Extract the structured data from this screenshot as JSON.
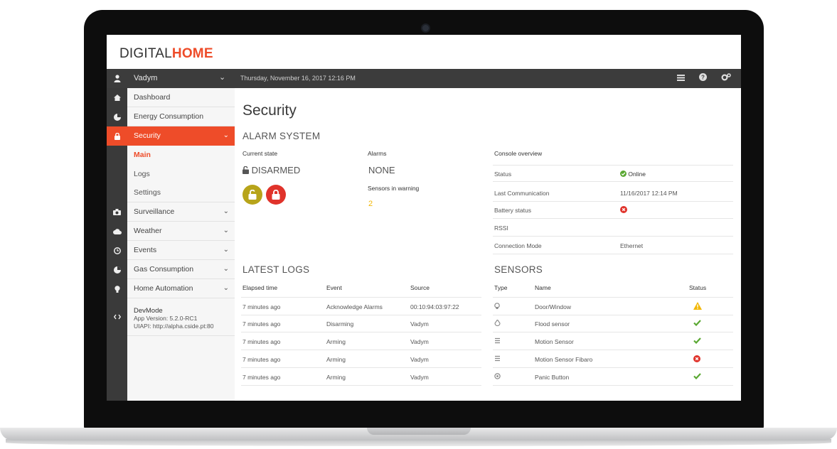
{
  "brand": {
    "part1": "DIGITAL",
    "part2": "HOME"
  },
  "topbar": {
    "user": "Vadym",
    "datetime": "Thursday, November 16, 2017 12:16 PM",
    "icons": [
      "list-icon",
      "help-icon",
      "settings-icon"
    ]
  },
  "sidebar": {
    "items": [
      {
        "label": "Dashboard",
        "icon": "home-icon"
      },
      {
        "label": "Energy Consumption",
        "icon": "pie-chart-icon"
      },
      {
        "label": "Security",
        "icon": "lock-icon",
        "active": true
      },
      {
        "label": "Surveillance",
        "icon": "camera-icon"
      },
      {
        "label": "Weather",
        "icon": "cloud-icon"
      },
      {
        "label": "Events",
        "icon": "clock-icon"
      },
      {
        "label": "Gas Consumption",
        "icon": "pie-chart-icon"
      },
      {
        "label": "Home Automation",
        "icon": "bulb-icon"
      }
    ],
    "security_sub": [
      "Main",
      "Logs",
      "Settings"
    ],
    "dev": {
      "title": "DevMode",
      "version": "App Version: 5.2.0-RC1",
      "uiapi": "UIAPI: http://alpha.cside.pt:80"
    }
  },
  "main": {
    "title": "Security",
    "alarm": {
      "heading": "ALARM SYSTEM",
      "current_state_label": "Current state",
      "current_state": "DISARMED",
      "alarms_label": "Alarms",
      "alarms": "NONE",
      "sensors_warning_label": "Sensors in warning",
      "sensors_warning": "2"
    },
    "console": {
      "heading": "Console overview",
      "rows": [
        {
          "k": "Status",
          "v": "Online",
          "state": "ok"
        },
        {
          "k": "Last Communication",
          "v": "11/16/2017 12:14 PM"
        },
        {
          "k": "Battery status",
          "v": "",
          "state": "error"
        },
        {
          "k": "RSSI",
          "v": ""
        },
        {
          "k": "Connection Mode",
          "v": "Ethernet"
        }
      ]
    },
    "logs": {
      "heading": "LATEST LOGS",
      "columns": [
        "Elapsed time",
        "Event",
        "Source"
      ],
      "rows": [
        [
          "7 minutes ago",
          "Acknowledge Alarms",
          "00:10:94:03:97:22"
        ],
        [
          "7 minutes ago",
          "Disarming",
          "Vadym"
        ],
        [
          "7 minutes ago",
          "Arming",
          "Vadym"
        ],
        [
          "7 minutes ago",
          "Arming",
          "Vadym"
        ],
        [
          "7 minutes ago",
          "Arming",
          "Vadym"
        ]
      ]
    },
    "sensors": {
      "heading": "SENSORS",
      "columns": [
        "Type",
        "Name",
        "Status"
      ],
      "rows": [
        {
          "name": "Door/Window",
          "status": "warning"
        },
        {
          "name": "Flood sensor",
          "status": "ok"
        },
        {
          "name": "Motion Sensor",
          "status": "ok"
        },
        {
          "name": "Motion Sensor Fibaro",
          "status": "error"
        },
        {
          "name": "Panic Button",
          "status": "ok"
        }
      ]
    }
  },
  "colors": {
    "accent": "#ee4c29",
    "ok": "#5aa832",
    "warning": "#f2b705",
    "error": "#e0332b",
    "unlock_button": "#b7a41a"
  }
}
